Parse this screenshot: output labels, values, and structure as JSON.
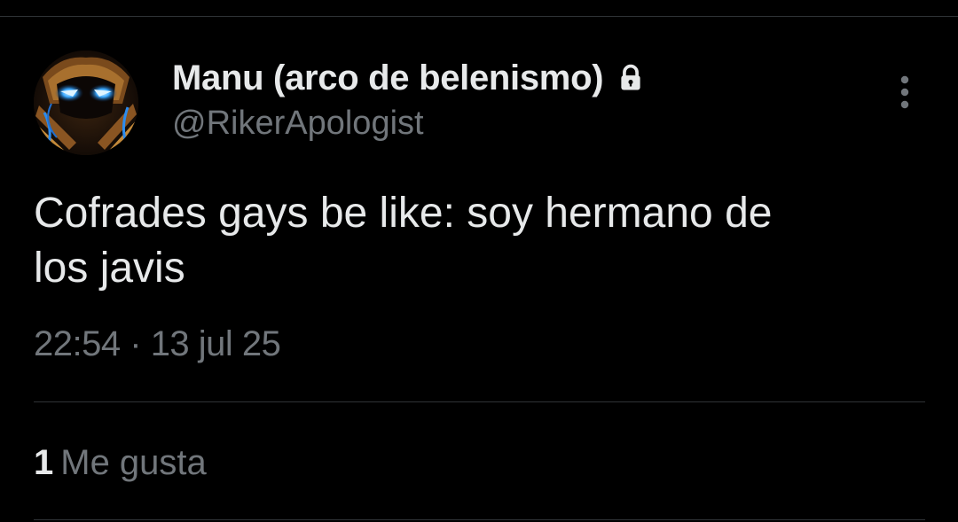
{
  "author": {
    "display_name": "Manu (arco de belenismo)",
    "handle": "@RikerApologist",
    "protected_icon": "lock-icon",
    "avatar_icon": "avatar"
  },
  "tweet": {
    "text_lines": [
      "Cofrades gays be like: soy hermano de",
      "los javis"
    ],
    "time": "22:54",
    "separator": "·",
    "date": "13 jul 25"
  },
  "stats": {
    "likes_count": "1",
    "likes_label": "Me gusta"
  },
  "menu_icon": "more-vertical-icon",
  "colors": {
    "background": "#000000",
    "primary_text": "#e7e9ea",
    "secondary_text": "#71767b",
    "divider": "#2f3336"
  }
}
